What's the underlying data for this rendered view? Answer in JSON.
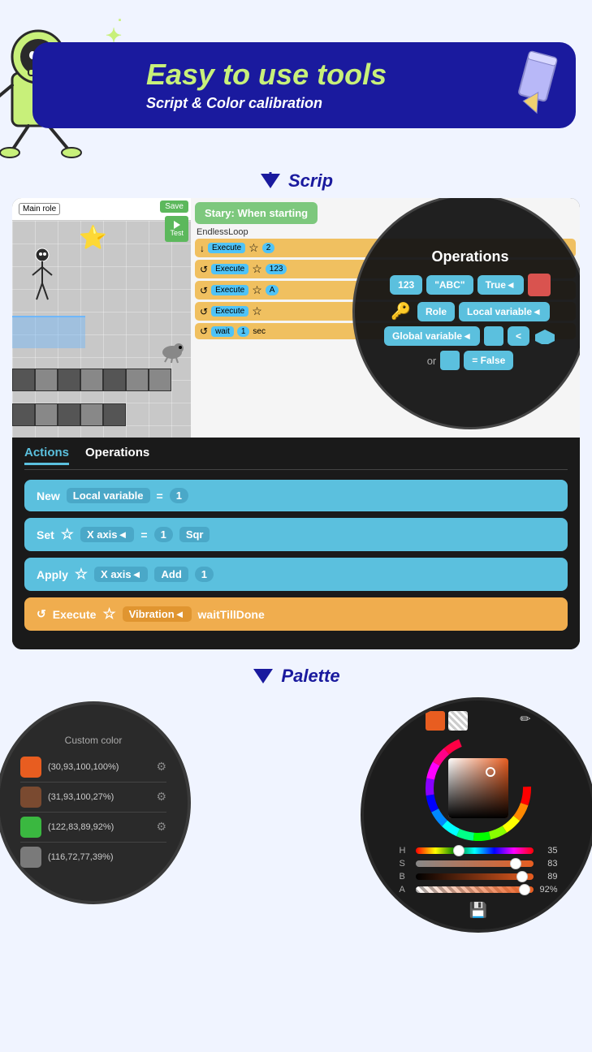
{
  "hero": {
    "title": "Easy to use tools",
    "subtitle": "Script & Color calibration"
  },
  "sections": {
    "script_label": "Scrip",
    "palette_label": "Palette"
  },
  "game": {
    "main_role": "Main role",
    "save_btn": "Save",
    "test_btn": "Test",
    "start_block": "Stary: When starting",
    "loop_label": "EndlessLoop"
  },
  "operations": {
    "title": "Operations",
    "buttons": [
      "123",
      "\"ABC\"",
      "True◄",
      "■",
      "Role",
      "Local variable◄",
      "Global variable◄",
      "□",
      "<",
      "◆",
      "or",
      "□",
      "= False"
    ]
  },
  "tabs": {
    "actions": "Actions",
    "operations": "Operations"
  },
  "action_blocks": [
    {
      "id": "block1",
      "content": "New Local variable = 1"
    },
    {
      "id": "block2",
      "content": "Set ☆ X axis◄ = 1 Sqr"
    },
    {
      "id": "block3",
      "content": "Apply ☆ X axis◄ Add 1"
    },
    {
      "id": "block4",
      "content": "Execute ☆ Vibration◄ waitTillDone",
      "style": "orange"
    }
  ],
  "custom_colors": {
    "title": "Custom color",
    "items": [
      {
        "value": "(30,93,100,100%)",
        "color": "#e85d20"
      },
      {
        "value": "(31,93,100,27%)",
        "color": "#7a4a30"
      },
      {
        "value": "(122,83,89,92%)",
        "color": "#3ab840"
      },
      {
        "value": "(116,72,77,39%)",
        "color": "#7a7a7a"
      }
    ]
  },
  "color_sliders": [
    {
      "label": "H",
      "value": "35",
      "percent": 35,
      "color": "linear-gradient(to right, red, yellow, green, cyan, blue, magenta, red)"
    },
    {
      "label": "S",
      "value": "83",
      "percent": 83,
      "color": "linear-gradient(to right, #888, #e85d20)"
    },
    {
      "label": "B",
      "value": "89",
      "percent": 89,
      "color": "linear-gradient(to right, #000, #e85d20)"
    },
    {
      "label": "A",
      "value": "92%",
      "percent": 92,
      "color": "linear-gradient(to right, transparent, #e85d20), repeating-linear-gradient(45deg, #ccc 0px, #ccc 5px, white 5px, white 10px)"
    }
  ]
}
